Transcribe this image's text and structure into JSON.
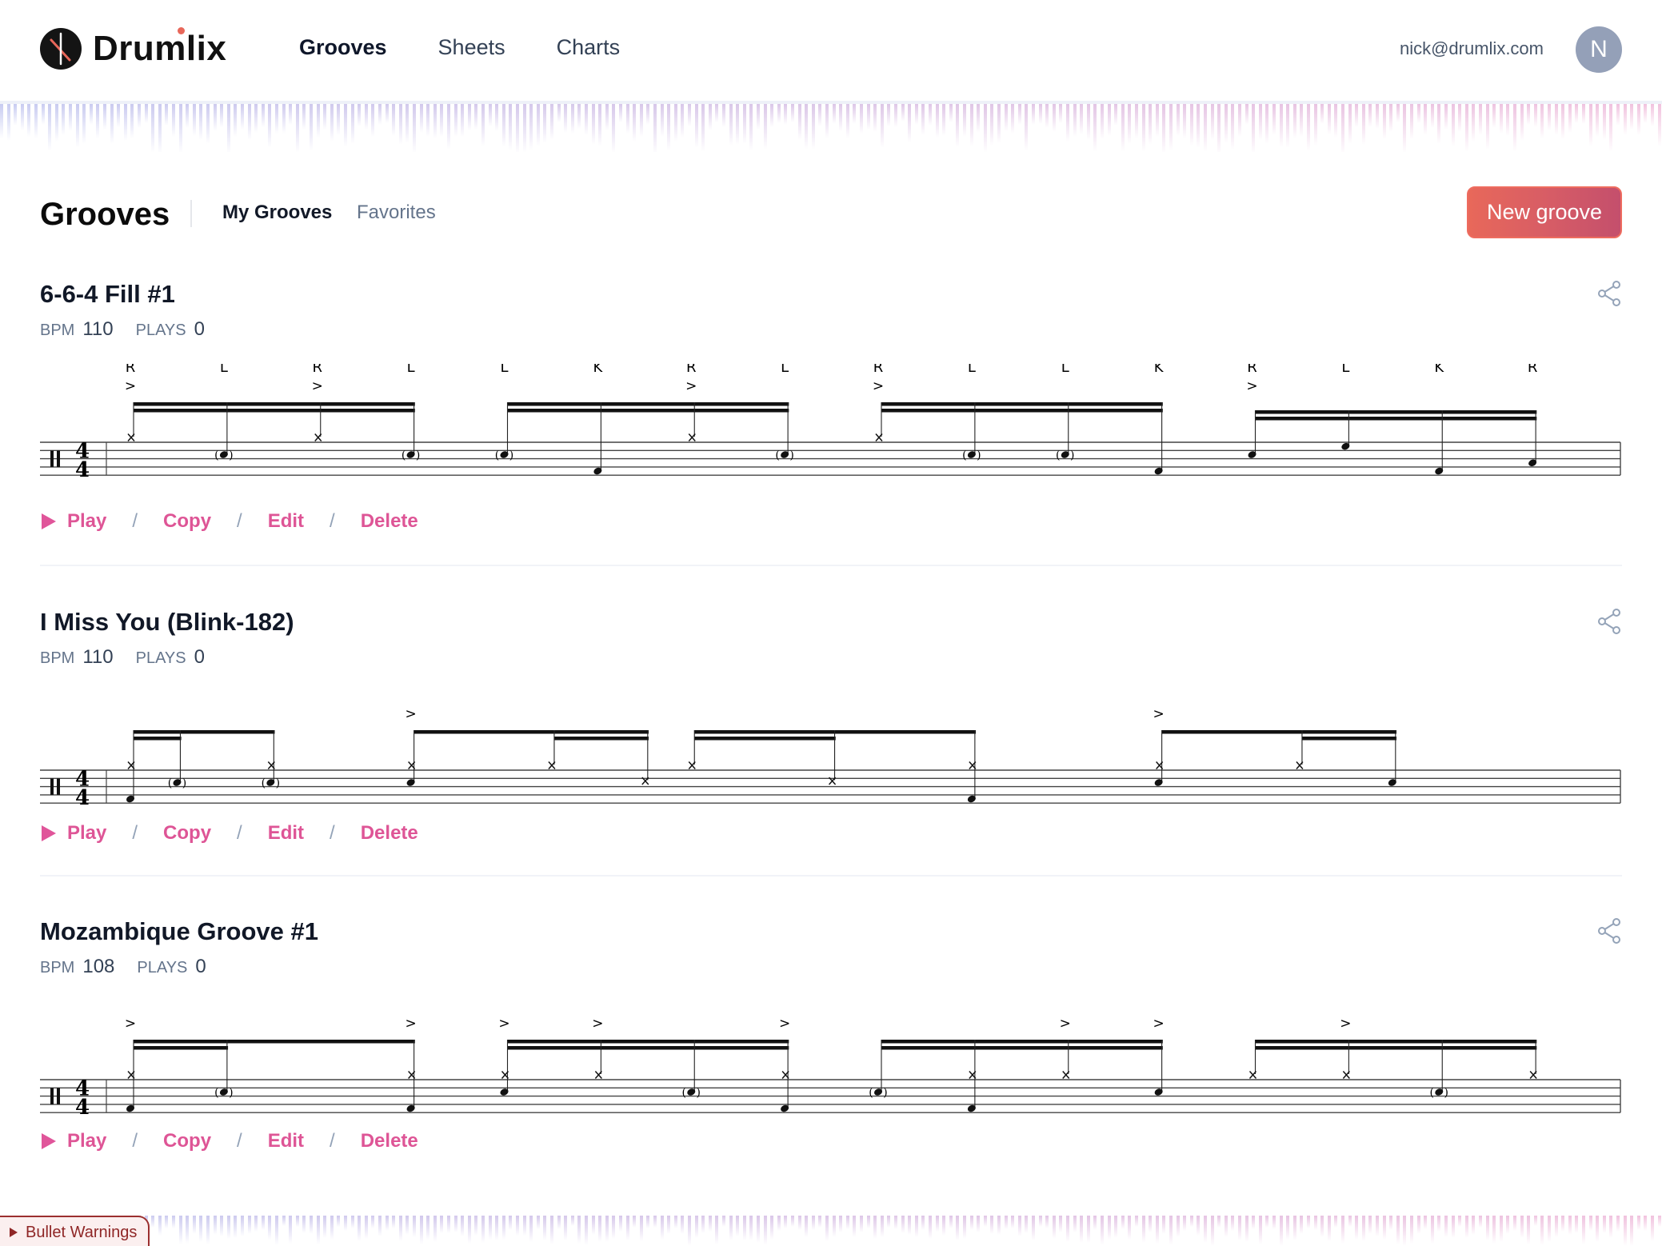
{
  "app": {
    "brand": "Drumlix",
    "nav": [
      {
        "label": "Grooves",
        "active": true
      },
      {
        "label": "Sheets",
        "active": false
      },
      {
        "label": "Charts",
        "active": false
      }
    ],
    "user_email": "nick@drumlix.com",
    "avatar_initial": "N"
  },
  "page": {
    "title": "Grooves",
    "tabs": [
      {
        "label": "My Grooves",
        "active": true
      },
      {
        "label": "Favorites",
        "active": false
      }
    ],
    "new_button": "New groove"
  },
  "labels": {
    "bpm": "BPM",
    "plays": "PLAYS",
    "actions": {
      "play": "Play",
      "copy": "Copy",
      "edit": "Edit",
      "delete": "Delete",
      "separator": "/"
    }
  },
  "colors": {
    "accent_pink": "#de5596",
    "button_gradient_start": "#e8685a",
    "button_gradient_end": "#c44f6c",
    "muted": "#64748b"
  },
  "grooves": [
    {
      "title": "6-6-4 Fill #1",
      "bpm": "110",
      "plays": "0",
      "time_signature": "4/4",
      "notes": [
        {
          "step": 0,
          "inst": "hihat",
          "accent": true,
          "sticking": "R"
        },
        {
          "step": 1,
          "inst": "snare",
          "ghost": true,
          "sticking": "L"
        },
        {
          "step": 2,
          "inst": "hihat",
          "accent": true,
          "sticking": "R"
        },
        {
          "step": 3,
          "inst": "snare",
          "ghost": true,
          "sticking": "L"
        },
        {
          "step": 4,
          "inst": "snare",
          "ghost": true,
          "sticking": "L"
        },
        {
          "step": 5,
          "inst": "kick",
          "sticking": "K"
        },
        {
          "step": 6,
          "inst": "hihat",
          "accent": true,
          "sticking": "R"
        },
        {
          "step": 7,
          "inst": "snare",
          "ghost": true,
          "sticking": "L"
        },
        {
          "step": 8,
          "inst": "hihat",
          "accent": true,
          "sticking": "R"
        },
        {
          "step": 9,
          "inst": "snare",
          "ghost": true,
          "sticking": "L"
        },
        {
          "step": 10,
          "inst": "snare",
          "ghost": true,
          "sticking": "L"
        },
        {
          "step": 11,
          "inst": "kick",
          "sticking": "K"
        },
        {
          "step": 12,
          "inst": "snare",
          "accent": true,
          "sticking": "R"
        },
        {
          "step": 13,
          "inst": "tom1",
          "sticking": "L"
        },
        {
          "step": 14,
          "inst": "kick",
          "sticking": "K"
        },
        {
          "step": 15,
          "inst": "floortom",
          "sticking": "R"
        }
      ],
      "beams": [
        {
          "steps": [
            0,
            1,
            2,
            3
          ],
          "pattern": "16"
        },
        {
          "steps": [
            4,
            5,
            6,
            7
          ],
          "pattern": "16"
        },
        {
          "steps": [
            8,
            9,
            10,
            11
          ],
          "pattern": "16"
        },
        {
          "steps": [
            12,
            13,
            14,
            15
          ],
          "pattern": "16",
          "lowered": true
        }
      ]
    },
    {
      "title": "I Miss You (Blink-182)",
      "bpm": "110",
      "plays": "0",
      "time_signature": "4/4",
      "notes": [
        {
          "step": 0,
          "inst": "hihat"
        },
        {
          "step": 0,
          "inst": "kick"
        },
        {
          "step": 1,
          "inst": "snare",
          "ghost": true
        },
        {
          "step": 3,
          "inst": "hihat"
        },
        {
          "step": 3,
          "inst": "snare",
          "ghost": true
        },
        {
          "step": 6,
          "inst": "hihat",
          "accent": true
        },
        {
          "step": 6,
          "inst": "snare"
        },
        {
          "step": 9,
          "inst": "hihat"
        },
        {
          "step": 11,
          "inst": "ride"
        },
        {
          "step": 12,
          "inst": "hihat"
        },
        {
          "step": 15,
          "inst": "ride"
        },
        {
          "step": 18,
          "inst": "hihat"
        },
        {
          "step": 18,
          "inst": "kick"
        },
        {
          "step": 22,
          "inst": "hihat",
          "accent": true
        },
        {
          "step": 22,
          "inst": "snare"
        },
        {
          "step": 25,
          "inst": "hihat"
        },
        {
          "step": 27,
          "inst": "snare"
        }
      ],
      "beams": [
        {
          "steps": [
            0,
            1,
            3
          ],
          "pattern": "16-16-8"
        },
        {
          "steps": [
            6,
            9,
            11
          ],
          "pattern": "8-16-16"
        },
        {
          "steps": [
            12,
            15,
            18
          ],
          "pattern": "16-16-8"
        },
        {
          "steps": [
            22,
            25,
            27
          ],
          "pattern": "8-16-16"
        }
      ]
    },
    {
      "title": "Mozambique Groove #1",
      "bpm": "108",
      "plays": "0",
      "time_signature": "4/4",
      "notes": [
        {
          "step": 0,
          "inst": "hihat",
          "accent": true
        },
        {
          "step": 0,
          "inst": "kick"
        },
        {
          "step": 1,
          "inst": "snare",
          "ghost": true
        },
        {
          "step": 3,
          "inst": "hihat",
          "accent": true
        },
        {
          "step": 3,
          "inst": "kick"
        },
        {
          "step": 4,
          "inst": "hihat",
          "accent": true
        },
        {
          "step": 4,
          "inst": "snare"
        },
        {
          "step": 5,
          "inst": "hihat",
          "accent": true
        },
        {
          "step": 6,
          "inst": "snare",
          "ghost": true
        },
        {
          "step": 7,
          "inst": "hihat",
          "accent": true
        },
        {
          "step": 7,
          "inst": "kick"
        },
        {
          "step": 8,
          "inst": "snare",
          "ghost": true
        },
        {
          "step": 9,
          "inst": "hihat"
        },
        {
          "step": 9,
          "inst": "kick"
        },
        {
          "step": 10,
          "inst": "hihat",
          "accent": true
        },
        {
          "step": 11,
          "inst": "snare",
          "accent": true
        },
        {
          "step": 12,
          "inst": "hihat"
        },
        {
          "step": 13,
          "inst": "hihat",
          "accent": true
        },
        {
          "step": 14,
          "inst": "snare",
          "ghost": true
        },
        {
          "step": 15,
          "inst": "hihat"
        }
      ],
      "beams": [
        {
          "steps": [
            0,
            1,
            3
          ],
          "pattern": "16-16-8"
        },
        {
          "steps": [
            4,
            5,
            6,
            7
          ],
          "pattern": "16"
        },
        {
          "steps": [
            8,
            9,
            10,
            11
          ],
          "pattern": "16"
        },
        {
          "steps": [
            12,
            13,
            14,
            15
          ],
          "pattern": "16"
        }
      ]
    }
  ],
  "debug_panel": {
    "label": "Bullet Warnings"
  }
}
